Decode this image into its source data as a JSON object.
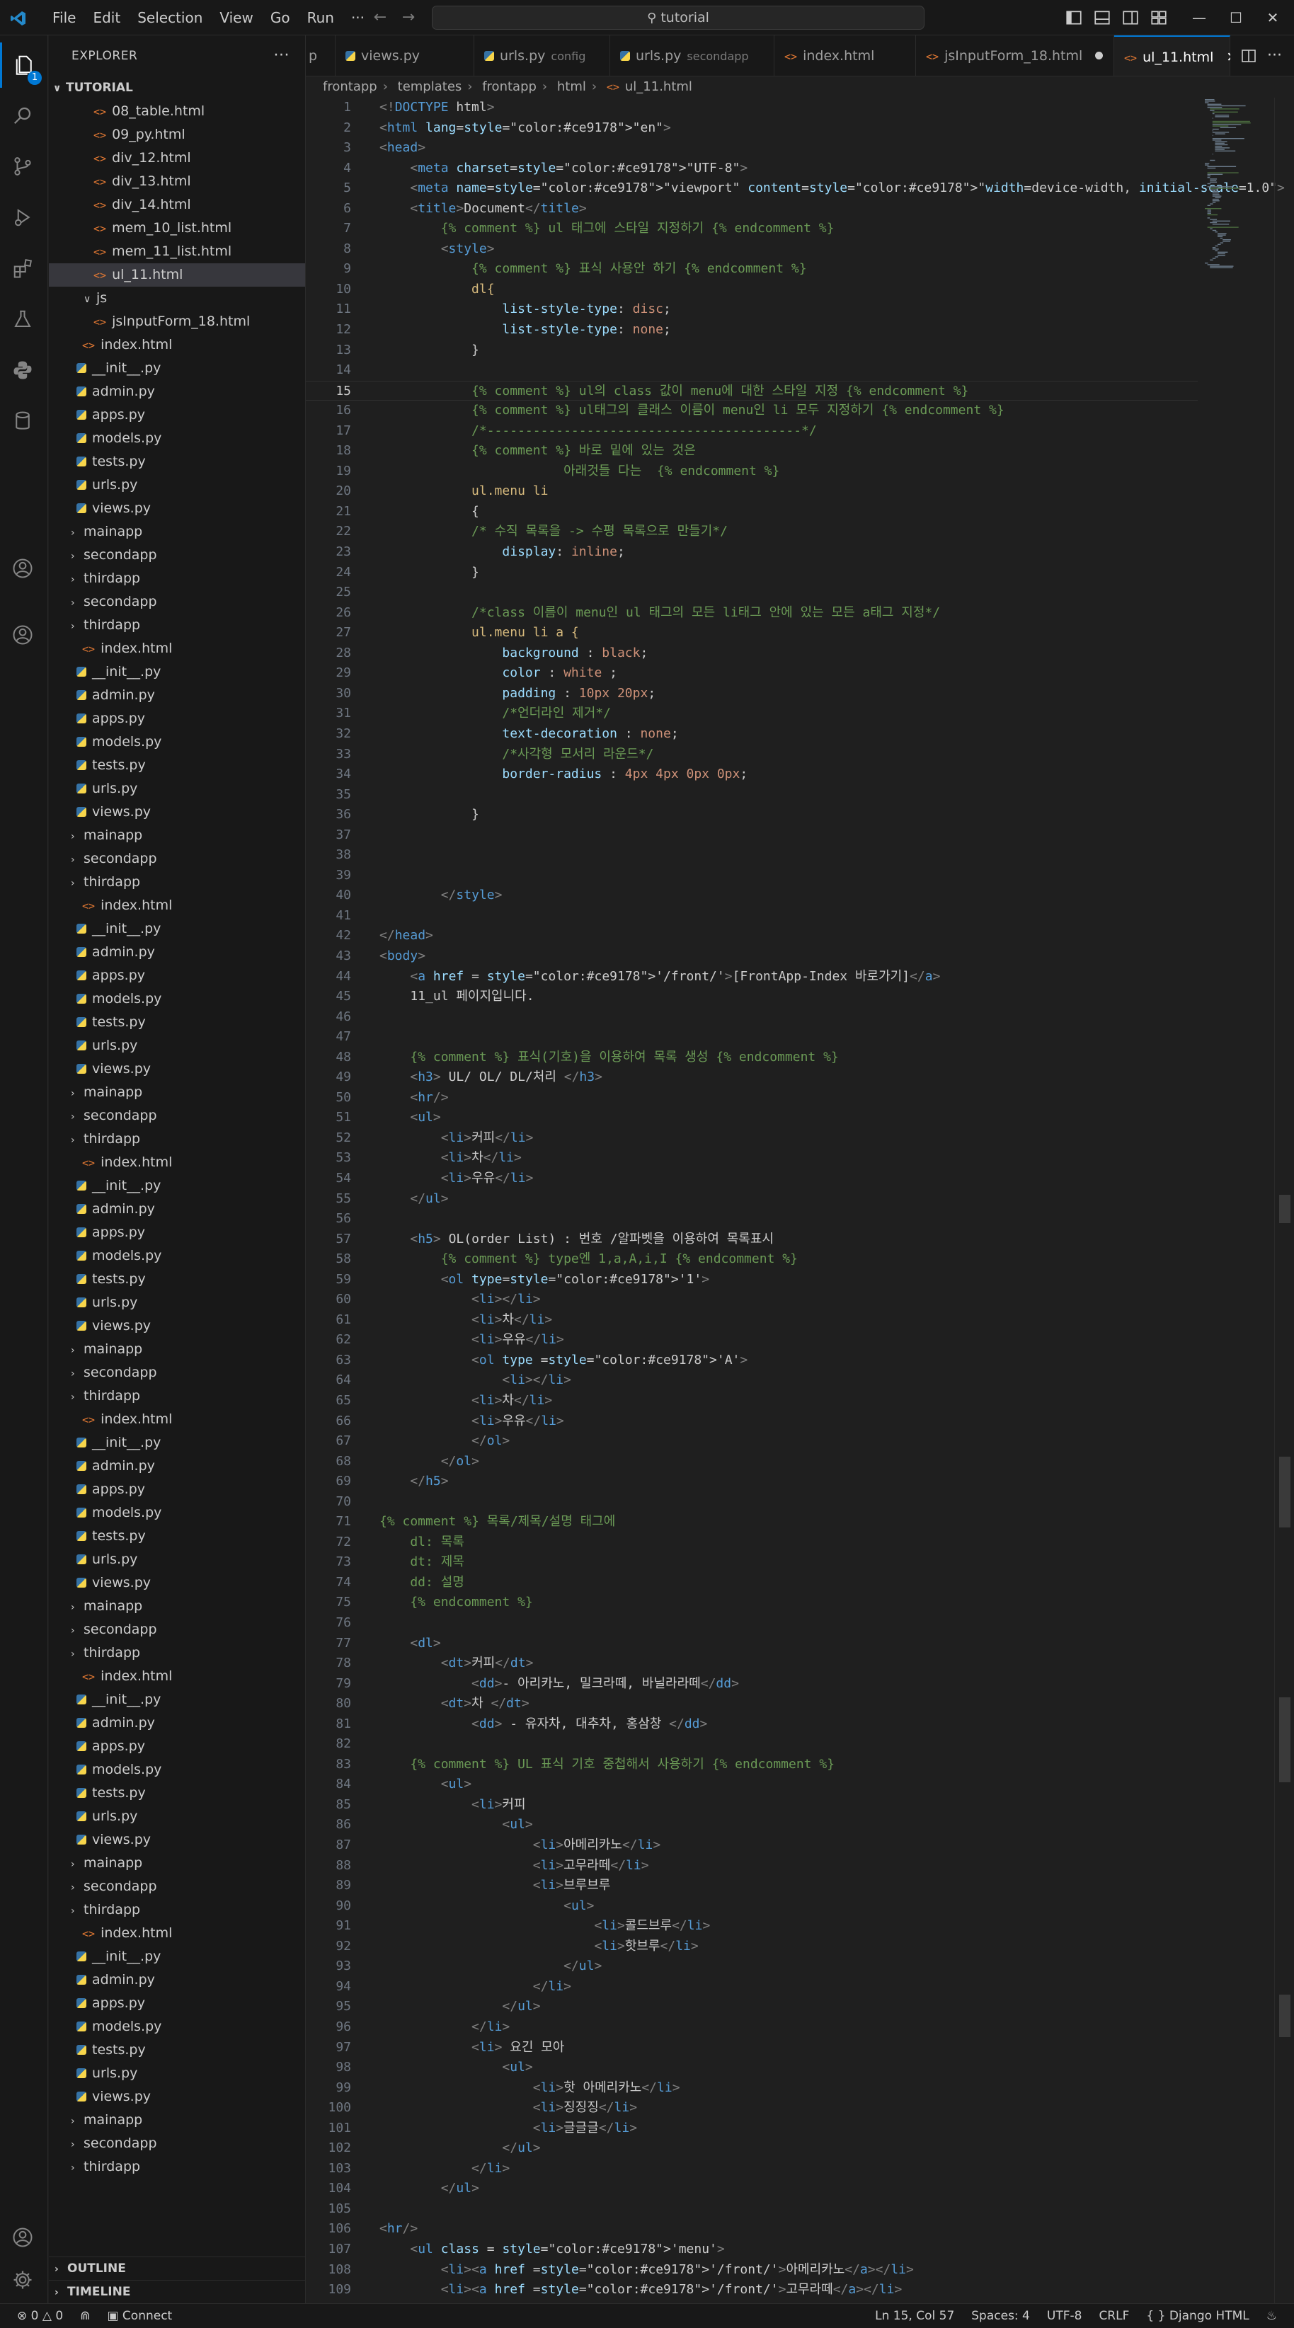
{
  "titlebar": {
    "menu": [
      "File",
      "Edit",
      "Selection",
      "View",
      "Go",
      "Run",
      "···"
    ],
    "search": "tutorial"
  },
  "activity": {
    "explorer_badge": "1"
  },
  "sidebar": {
    "title": "EXPLORER",
    "more": "···",
    "root": "TUTORIAL",
    "rows": [
      {
        "t": "html",
        "label": "08_table.html",
        "ind": 132
      },
      {
        "t": "html",
        "label": "09_py.html",
        "ind": 132
      },
      {
        "t": "html",
        "label": "div_12.html",
        "ind": 132
      },
      {
        "t": "html",
        "label": "div_13.html",
        "ind": 132
      },
      {
        "t": "html",
        "label": "div_14.html",
        "ind": 132
      },
      {
        "t": "html",
        "label": "mem_10_list.html",
        "ind": 132
      },
      {
        "t": "html",
        "label": "mem_11_list.html",
        "ind": 132
      },
      {
        "t": "html",
        "label": "ul_11.html",
        "ind": 132,
        "sel": true
      },
      {
        "t": "folder-open",
        "label": "js",
        "ind": 118
      },
      {
        "t": "html",
        "label": "jsInputForm_18.html",
        "ind": 132
      },
      {
        "t": "html",
        "label": "index.html",
        "ind": 116
      },
      {
        "t": "py",
        "label": "__init__.py",
        "ind": 108
      },
      {
        "t": "py",
        "label": "admin.py",
        "ind": 108
      },
      {
        "t": "py",
        "label": "apps.py",
        "ind": 108
      },
      {
        "t": "py",
        "label": "models.py",
        "ind": 108
      },
      {
        "t": "py",
        "label": "tests.py",
        "ind": 108
      },
      {
        "t": "py",
        "label": "urls.py",
        "ind": 108
      },
      {
        "t": "py",
        "label": "views.py",
        "ind": 108
      },
      {
        "t": "folder",
        "label": "mainapp",
        "ind": 100
      },
      {
        "t": "folder",
        "label": "secondapp",
        "ind": 100
      },
      {
        "t": "folder",
        "label": "thirdapp",
        "ind": 100
      },
      {
        "t": "folder",
        "label": "secondapp",
        "ind": 100
      },
      {
        "t": "folder",
        "label": "thirdapp",
        "ind": 100
      },
      {
        "t": "html",
        "label": "index.html",
        "ind": 116
      },
      {
        "t": "py",
        "label": "__init__.py",
        "ind": 108
      },
      {
        "t": "py",
        "label": "admin.py",
        "ind": 108
      },
      {
        "t": "py",
        "label": "apps.py",
        "ind": 108
      },
      {
        "t": "py",
        "label": "models.py",
        "ind": 108
      },
      {
        "t": "py",
        "label": "tests.py",
        "ind": 108
      },
      {
        "t": "py",
        "label": "urls.py",
        "ind": 108
      },
      {
        "t": "py",
        "label": "views.py",
        "ind": 108
      },
      {
        "t": "folder",
        "label": "mainapp",
        "ind": 100
      },
      {
        "t": "folder",
        "label": "secondapp",
        "ind": 100
      },
      {
        "t": "folder",
        "label": "thirdapp",
        "ind": 100
      },
      {
        "t": "html",
        "label": "index.html",
        "ind": 116
      },
      {
        "t": "py",
        "label": "__init__.py",
        "ind": 108
      },
      {
        "t": "py",
        "label": "admin.py",
        "ind": 108
      },
      {
        "t": "py",
        "label": "apps.py",
        "ind": 108
      },
      {
        "t": "py",
        "label": "models.py",
        "ind": 108
      },
      {
        "t": "py",
        "label": "tests.py",
        "ind": 108
      },
      {
        "t": "py",
        "label": "urls.py",
        "ind": 108
      },
      {
        "t": "py",
        "label": "views.py",
        "ind": 108
      },
      {
        "t": "folder",
        "label": "mainapp",
        "ind": 100
      },
      {
        "t": "folder",
        "label": "secondapp",
        "ind": 100
      },
      {
        "t": "folder",
        "label": "thirdapp",
        "ind": 100
      },
      {
        "t": "html",
        "label": "index.html",
        "ind": 116
      },
      {
        "t": "py",
        "label": "__init__.py",
        "ind": 108
      },
      {
        "t": "py",
        "label": "admin.py",
        "ind": 108
      },
      {
        "t": "py",
        "label": "apps.py",
        "ind": 108
      },
      {
        "t": "py",
        "label": "models.py",
        "ind": 108
      },
      {
        "t": "py",
        "label": "tests.py",
        "ind": 108
      },
      {
        "t": "py",
        "label": "urls.py",
        "ind": 108
      },
      {
        "t": "py",
        "label": "views.py",
        "ind": 108
      },
      {
        "t": "folder",
        "label": "mainapp",
        "ind": 100
      },
      {
        "t": "folder",
        "label": "secondapp",
        "ind": 100
      },
      {
        "t": "folder",
        "label": "thirdapp",
        "ind": 100
      },
      {
        "t": "html",
        "label": "index.html",
        "ind": 116
      },
      {
        "t": "py",
        "label": "__init__.py",
        "ind": 108
      },
      {
        "t": "py",
        "label": "admin.py",
        "ind": 108
      },
      {
        "t": "py",
        "label": "apps.py",
        "ind": 108
      },
      {
        "t": "py",
        "label": "models.py",
        "ind": 108
      },
      {
        "t": "py",
        "label": "tests.py",
        "ind": 108
      },
      {
        "t": "py",
        "label": "urls.py",
        "ind": 108
      },
      {
        "t": "py",
        "label": "views.py",
        "ind": 108
      },
      {
        "t": "folder",
        "label": "mainapp",
        "ind": 100
      },
      {
        "t": "folder",
        "label": "secondapp",
        "ind": 100
      },
      {
        "t": "folder",
        "label": "thirdapp",
        "ind": 100
      },
      {
        "t": "html",
        "label": "index.html",
        "ind": 116
      },
      {
        "t": "py",
        "label": "__init__.py",
        "ind": 108
      },
      {
        "t": "py",
        "label": "admin.py",
        "ind": 108
      },
      {
        "t": "py",
        "label": "apps.py",
        "ind": 108
      },
      {
        "t": "py",
        "label": "models.py",
        "ind": 108
      },
      {
        "t": "py",
        "label": "tests.py",
        "ind": 108
      },
      {
        "t": "py",
        "label": "urls.py",
        "ind": 108
      },
      {
        "t": "py",
        "label": "views.py",
        "ind": 108
      },
      {
        "t": "folder",
        "label": "mainapp",
        "ind": 100
      },
      {
        "t": "folder",
        "label": "secondapp",
        "ind": 100
      },
      {
        "t": "folder",
        "label": "thirdapp",
        "ind": 100
      },
      {
        "t": "html",
        "label": "index.html",
        "ind": 116
      },
      {
        "t": "py",
        "label": "__init__.py",
        "ind": 108
      },
      {
        "t": "py",
        "label": "admin.py",
        "ind": 108
      },
      {
        "t": "py",
        "label": "apps.py",
        "ind": 108
      },
      {
        "t": "py",
        "label": "models.py",
        "ind": 108
      },
      {
        "t": "py",
        "label": "tests.py",
        "ind": 108
      },
      {
        "t": "py",
        "label": "urls.py",
        "ind": 108
      },
      {
        "t": "py",
        "label": "views.py",
        "ind": 108
      },
      {
        "t": "folder",
        "label": "mainapp",
        "ind": 100
      },
      {
        "t": "folder",
        "label": "secondapp",
        "ind": 100
      },
      {
        "t": "folder",
        "label": "thirdapp",
        "ind": 100
      }
    ],
    "outline": "OUTLINE",
    "timeline": "TIMELINE"
  },
  "tabs": [
    {
      "label": "p",
      "kind": "none"
    },
    {
      "label": "views.py",
      "kind": "py"
    },
    {
      "label": "urls.py",
      "desc": "config",
      "kind": "py"
    },
    {
      "label": "urls.py",
      "desc": "secondapp",
      "kind": "py"
    },
    {
      "label": "index.html",
      "kind": "html"
    },
    {
      "label": "jsInputForm_18.html",
      "kind": "html",
      "dirty": true
    },
    {
      "label": "ul_11.html",
      "kind": "html",
      "active": true
    }
  ],
  "breadcrumb": [
    "frontapp",
    "templates",
    "frontapp",
    "html",
    "ul_11.html"
  ],
  "code": {
    "current_line": 15,
    "lines": [
      "<!DOCTYPE html>",
      "<html lang=\"en\">",
      "<head>",
      "    <meta charset=\"UTF-8\">",
      "    <meta name=\"viewport\" content=\"width=device-width, initial-scale=1.0\">",
      "    <title>Document</title>",
      "        {% comment %} ul 태그에 스타일 지정하기 {% endcomment %}",
      "        <style>",
      "            {% comment %} 표식 사용안 하기 {% endcomment %}",
      "            dl{",
      "                list-style-type: disc;",
      "                list-style-type: none;",
      "            }",
      "",
      "            {% comment %} ul의 class 값이 menu에 대한 스타일 지정 {% endcomment %}",
      "            {% comment %} ul태그의 클래스 이름이 menu인 li 모두 지정하기 {% endcomment %}",
      "            /*-----------------------------------------*/",
      "            {% comment %} 바로 밑에 있는 것은",
      "                        아래것들 다는  {% endcomment %}",
      "            ul.menu li",
      "            {",
      "            /* 수직 목록을 -> 수평 목록으로 만들기*/",
      "                display: inline;",
      "            }",
      "",
      "            /*class 이름이 menu인 ul 태그의 모든 li태그 안에 있는 모든 a태그 지정*/",
      "            ul.menu li a {",
      "                background : black;",
      "                color : white ;",
      "                padding : 10px 20px;",
      "                /*언더라인 제거*/",
      "                text-decoration : none;",
      "                /*사각형 모서리 라운드*/",
      "                border-radius : 4px 4px 0px 0px;",
      "",
      "            }",
      "",
      "",
      "",
      "        </style>",
      "",
      "</head>",
      "<body>",
      "    <a href = '/front/'>[FrontApp-Index 바로가기]</a>",
      "    11_ul 페이지입니다.",
      "",
      "",
      "    {% comment %} 표식(기호)을 이용하여 목록 생성 {% endcomment %}",
      "    <h3> UL/ OL/ DL/처리 </h3>",
      "    <hr/>",
      "    <ul>",
      "        <li>커피</li>",
      "        <li>차</li>",
      "        <li>우유</li>",
      "    </ul>",
      "",
      "    <h5> OL(order List) : 번호 /알파벳을 이용하여 목록표시",
      "        {% comment %} type엔 1,a,A,i,I {% endcomment %}",
      "        <ol type='1'>",
      "            <li></li>",
      "            <li>차</li>",
      "            <li>우유</li>",
      "            <ol type ='A'>",
      "                <li></li>",
      "            <li>차</li>",
      "            <li>우유</li>",
      "            </ol>",
      "        </ol>",
      "    </h5>",
      "",
      "{% comment %} 목록/제목/설명 태그에",
      "    dl: 목록",
      "    dt: 제목",
      "    dd: 설명",
      "    {% endcomment %}",
      "",
      "    <dl>",
      "        <dt>커피</dt>",
      "            <dd>- 아리카노, 밀크라떼, 바닐라라떼</dd>",
      "        <dt>차 </dt>",
      "            <dd> - 유자차, 대추차, 홍삼창 </dd>",
      "",
      "    {% comment %} UL 표식 기호 중첩해서 사용하기 {% endcomment %}",
      "        <ul>",
      "            <li>커피",
      "                <ul>",
      "                    <li>아메리카노</li>",
      "                    <li>고무라떼</li>",
      "                    <li>브루브루",
      "                        <ul>",
      "                            <li>콜드브루</li>",
      "                            <li>핫브루</li>",
      "                        </ul>",
      "                    </li>",
      "                </ul>",
      "            </li>",
      "            <li> 요긴 모아",
      "                <ul>",
      "                    <li>핫 아메리카노</li>",
      "                    <li>징징징</li>",
      "                    <li>글글글</li>",
      "                </ul>",
      "            </li>",
      "        </ul>",
      "",
      "<hr/>",
      "    <ul class = 'menu'>",
      "        <li><a href ='/front/'>아메리카노</a></li>",
      "        <li><a href ='/front/'>고무라떼</a></li>"
    ]
  },
  "status": {
    "errors": "0",
    "warnings": "0",
    "connect": "Connect",
    "position": "Ln 15, Col 57",
    "spaces": "Spaces: 4",
    "encoding": "UTF-8",
    "eol": "CRLF",
    "language": "Django HTML"
  },
  "colors": {
    "accent": "#0078d4",
    "keyword": "#569cd6",
    "attr": "#9cdcfe",
    "string": "#ce9178",
    "comment": "#6a9955",
    "punct": "#808080",
    "text": "#cccccc",
    "django": "#6a9955"
  }
}
